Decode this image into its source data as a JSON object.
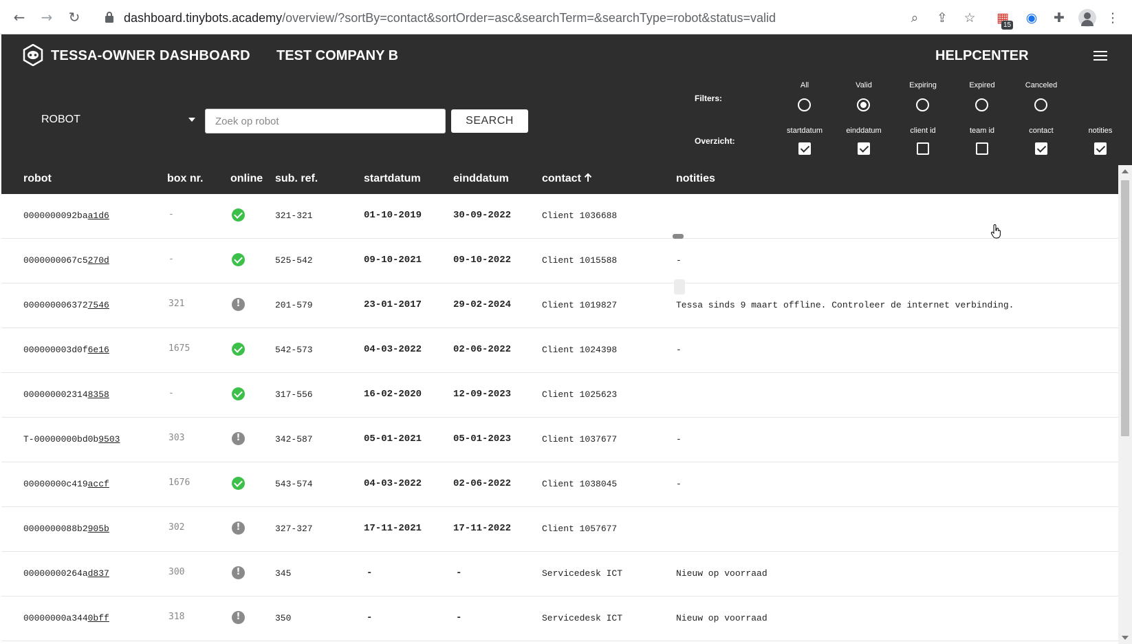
{
  "browser": {
    "url_host": "dashboard.tinybots.academy",
    "url_rest": "/overview/?sortBy=contact&sortOrder=asc&searchTerm=&searchType=robot&status=valid",
    "extension_badge": "15"
  },
  "header": {
    "app_title": "TESSA-OWNER DASHBOARD",
    "company": "TEST COMPANY B",
    "helpcenter": "HELPCENTER"
  },
  "search": {
    "type_value": "ROBOT",
    "placeholder": "Zoek op robot",
    "button_label": "SEARCH"
  },
  "filters": {
    "label": "Filters:",
    "options": [
      {
        "label": "All",
        "checked": false
      },
      {
        "label": "Valid",
        "checked": true
      },
      {
        "label": "Expiring",
        "checked": false
      },
      {
        "label": "Expired",
        "checked": false
      },
      {
        "label": "Canceled",
        "checked": false
      }
    ]
  },
  "overview": {
    "label": "Overzicht:",
    "options": [
      {
        "label": "startdatum",
        "checked": true
      },
      {
        "label": "einddatum",
        "checked": true
      },
      {
        "label": "client id",
        "checked": false
      },
      {
        "label": "team id",
        "checked": false
      },
      {
        "label": "contact",
        "checked": true
      },
      {
        "label": "notities",
        "checked": true
      }
    ]
  },
  "table": {
    "columns": {
      "robot": "robot",
      "box": "box nr.",
      "online": "online",
      "subref": "sub. ref.",
      "start": "startdatum",
      "end": "einddatum",
      "contact": "contact",
      "notes": "notities"
    },
    "rows": [
      {
        "robot_prefix": "0000000092ba",
        "robot_link": "a1d6",
        "box": "-",
        "online": true,
        "subref": "321-321",
        "start": "01-10-2019",
        "end": "30-09-2022",
        "contact": "Client 1036688",
        "notes": ""
      },
      {
        "robot_prefix": "0000000067c5",
        "robot_link": "270d",
        "box": "-",
        "online": true,
        "subref": "525-542",
        "start": "09-10-2021",
        "end": "09-10-2022",
        "contact": "Client 1015588",
        "notes": "-"
      },
      {
        "robot_prefix": "000000006372",
        "robot_link": "7546",
        "box": "321",
        "online": false,
        "subref": "201-579",
        "start": "23-01-2017",
        "end": "29-02-2024",
        "contact": "Client 1019827",
        "notes": "Tessa sinds 9 maart offline. Controleer de internet verbinding."
      },
      {
        "robot_prefix": "000000003d0f",
        "robot_link": "6e16",
        "box": "1675",
        "online": true,
        "subref": "542-573",
        "start": "04-03-2022",
        "end": "02-06-2022",
        "contact": "Client 1024398",
        "notes": "-"
      },
      {
        "robot_prefix": "000000002314",
        "robot_link": "8358",
        "box": "-",
        "online": true,
        "subref": "317-556",
        "start": "16-02-2020",
        "end": "12-09-2023",
        "contact": "Client 1025623",
        "notes": ""
      },
      {
        "robot_prefix": "T-00000000bd0b",
        "robot_link": "9503",
        "box": "303",
        "online": false,
        "subref": "342-587",
        "start": "05-01-2021",
        "end": "05-01-2023",
        "contact": "Client 1037677",
        "notes": "-"
      },
      {
        "robot_prefix": "00000000c419",
        "robot_link": "accf",
        "box": "1676",
        "online": true,
        "subref": "543-574",
        "start": "04-03-2022",
        "end": "02-06-2022",
        "contact": "Client 1038045",
        "notes": "-"
      },
      {
        "robot_prefix": "0000000088b2",
        "robot_link": "905b",
        "box": "302",
        "online": false,
        "subref": "327-327",
        "start": "17-11-2021",
        "end": "17-11-2022",
        "contact": "Client 1057677",
        "notes": ""
      },
      {
        "robot_prefix": "00000000264a",
        "robot_link": "d837",
        "box": "300",
        "online": false,
        "subref": "345",
        "start": "-",
        "end": "-",
        "contact": "Servicedesk ICT",
        "notes": "Nieuw op voorraad"
      },
      {
        "robot_prefix": "00000000a344",
        "robot_link": "0bff",
        "box": "318",
        "online": false,
        "subref": "350",
        "start": "-",
        "end": "-",
        "contact": "Servicedesk ICT",
        "notes": "Nieuw op voorraad"
      }
    ]
  },
  "colors": {
    "header_bg": "#2e2e2e",
    "online": "#3cc04a",
    "offline": "#8a8a8a"
  }
}
